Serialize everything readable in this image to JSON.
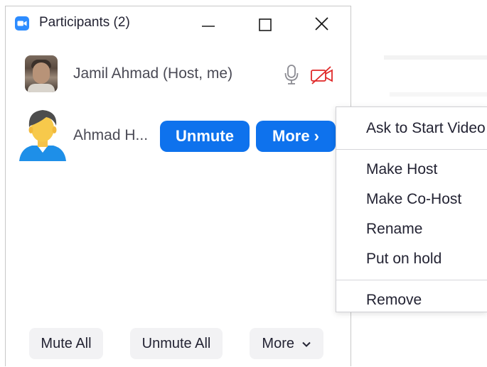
{
  "window": {
    "title": "Participants (2)",
    "app_icon": "zoom-camera-icon"
  },
  "participants": [
    {
      "name": "Jamil Ahmad (Host, me)",
      "avatar": "photo",
      "mic_icon": "microphone-icon",
      "video_icon": "video-off-icon"
    },
    {
      "name": "Ahmad H...",
      "avatar": "default-user-avatar",
      "unmute_label": "Unmute",
      "more_label": "More"
    }
  ],
  "context_menu": {
    "items": [
      "Ask to Start Video",
      "Make Host",
      "Make Co-Host",
      "Rename",
      "Put on hold",
      "Remove"
    ]
  },
  "toolbar": {
    "mute_all": "Mute All",
    "unmute_all": "Unmute All",
    "more": "More"
  },
  "colors": {
    "accent": "#0e72ed",
    "video_off": "#e02828",
    "button_gray": "#f2f2f4"
  }
}
